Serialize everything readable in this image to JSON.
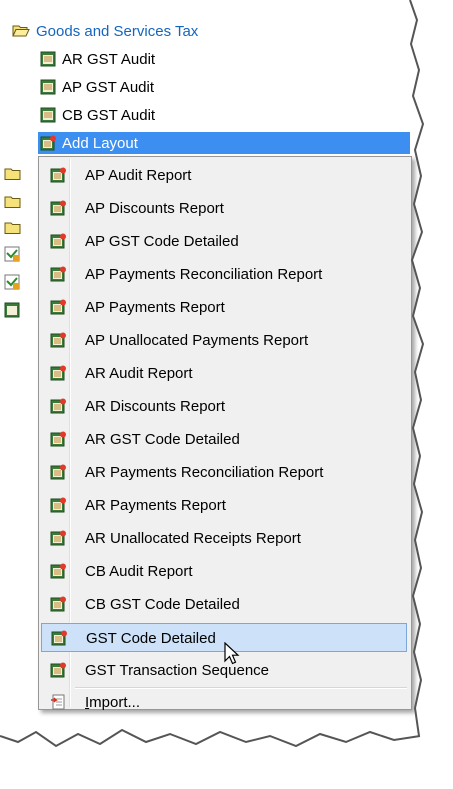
{
  "tree": {
    "group_label": "Goods and Services Tax",
    "items": [
      {
        "label": "AR GST Audit"
      },
      {
        "label": "AP GST Audit"
      },
      {
        "label": "CB GST Audit"
      }
    ],
    "selected_label": "Add Layout"
  },
  "menu": {
    "items": [
      {
        "label": "AP Audit Report"
      },
      {
        "label": "AP Discounts Report"
      },
      {
        "label": "AP GST Code Detailed"
      },
      {
        "label": "AP Payments Reconciliation Report"
      },
      {
        "label": "AP Payments Report"
      },
      {
        "label": "AP Unallocated Payments Report"
      },
      {
        "label": "AR Audit Report"
      },
      {
        "label": "AR Discounts Report"
      },
      {
        "label": "AR GST Code Detailed"
      },
      {
        "label": "AR Payments Reconciliation Report"
      },
      {
        "label": "AR Payments Report"
      },
      {
        "label": "AR Unallocated Receipts Report"
      },
      {
        "label": "CB Audit Report"
      },
      {
        "label": "CB GST Code Detailed"
      },
      {
        "label": "GST Code Detailed"
      },
      {
        "label": "GST Transaction Sequence"
      }
    ],
    "import_label": "Import...",
    "hovered_item": "GST Code Detailed"
  },
  "colors": {
    "selection": "#3c8ff0",
    "hover": "#cde2f8",
    "group_text": "#1565c0"
  }
}
